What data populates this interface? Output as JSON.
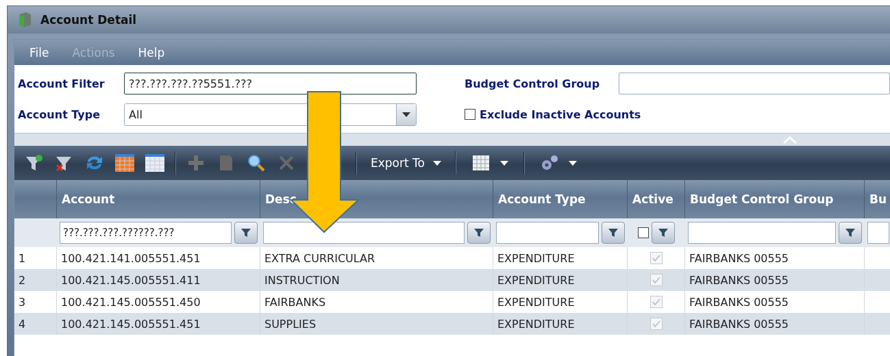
{
  "window": {
    "title": "Account Detail"
  },
  "menu": [
    {
      "label": "File",
      "disabled": false
    },
    {
      "label": "Actions",
      "disabled": true
    },
    {
      "label": "Help",
      "disabled": false
    }
  ],
  "filters": {
    "account_filter": {
      "label": "Account Filter",
      "value": "???.???.???.??5551.???"
    },
    "account_type": {
      "label": "Account Type",
      "value": "All"
    },
    "budget_control_group": {
      "label": "Budget Control Group"
    },
    "exclude_inactive": {
      "label": "Exclude Inactive Accounts",
      "checked": false
    }
  },
  "toolbar": {
    "buttons": [
      {
        "kind": "filter-add",
        "disabled": false
      },
      {
        "kind": "filter-clear",
        "disabled": false
      },
      {
        "kind": "refresh",
        "disabled": false
      },
      {
        "kind": "grid-orange",
        "disabled": false
      },
      {
        "kind": "grid-blue",
        "disabled": false
      },
      {
        "kind": "separator"
      },
      {
        "kind": "add",
        "disabled": true
      },
      {
        "kind": "edit",
        "disabled": true
      },
      {
        "kind": "search",
        "disabled": false
      },
      {
        "kind": "delete",
        "disabled": true
      }
    ],
    "export": {
      "label": "Export To"
    }
  },
  "table": {
    "columns": [
      {
        "label": "Account",
        "filter": "???.???.???.??????.???"
      },
      {
        "label": "Desc"
      },
      {
        "label": "Account Type"
      },
      {
        "label": "Active",
        "filter_checked": false
      },
      {
        "label": "Budget Control Group"
      },
      {
        "label": "Bu"
      }
    ],
    "rows": [
      {
        "number": "1",
        "account": "100.421.141.005551.451",
        "description": "EXTRA CURRICULAR",
        "type": "EXPENDITURE",
        "active": true,
        "group": "FAIRBANKS 00555"
      },
      {
        "number": "2",
        "account": "100.421.145.005551.411",
        "description": "INSTRUCTION",
        "type": "EXPENDITURE",
        "active": true,
        "group": "FAIRBANKS 00555"
      },
      {
        "number": "3",
        "account": "100.421.145.005551.450",
        "description": "FAIRBANKS",
        "type": "EXPENDITURE",
        "active": true,
        "group": "FAIRBANKS 00555"
      },
      {
        "number": "4",
        "account": "100.421.145.005551.451",
        "description": "SUPPLIES",
        "type": "EXPENDITURE",
        "active": true,
        "group": "FAIRBANKS 00555"
      }
    ]
  }
}
